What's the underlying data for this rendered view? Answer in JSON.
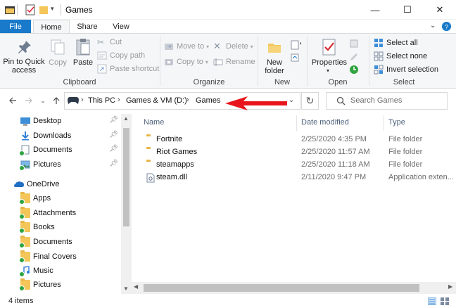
{
  "window": {
    "title": "Games",
    "controls": {
      "minimize": "—",
      "maximize": "☐",
      "close": "✕"
    }
  },
  "ribbon": {
    "tabs": [
      {
        "label": "File"
      },
      {
        "label": "Home"
      },
      {
        "label": "Share"
      },
      {
        "label": "View"
      }
    ],
    "clipboard": {
      "pin_label": "Pin to Quick access",
      "copy_label": "Copy",
      "paste_label": "Paste",
      "cut_label": "Cut",
      "copy_path_label": "Copy path",
      "paste_shortcut_label": "Paste shortcut",
      "group_label": "Clipboard"
    },
    "organize": {
      "move_to_label": "Move to",
      "copy_to_label": "Copy to",
      "delete_label": "Delete",
      "rename_label": "Rename",
      "group_label": "Organize"
    },
    "new": {
      "new_folder_label": "New folder",
      "group_label": "New"
    },
    "open": {
      "properties_label": "Properties",
      "group_label": "Open"
    },
    "select": {
      "select_all_label": "Select all",
      "select_none_label": "Select none",
      "invert_label": "Invert selection",
      "group_label": "Select"
    }
  },
  "address": {
    "crumbs": [
      "This PC",
      "Games & VM (D:)",
      "Games"
    ],
    "search_placeholder": "Search Games"
  },
  "nav": {
    "quick_access": [
      {
        "label": "Desktop",
        "icon": "desktop-icon",
        "pinned": true
      },
      {
        "label": "Downloads",
        "icon": "downloads-icon",
        "pinned": true
      },
      {
        "label": "Documents",
        "icon": "documents-icon",
        "pinned": true
      },
      {
        "label": "Pictures",
        "icon": "pictures-icon",
        "pinned": true
      }
    ],
    "onedrive_label": "OneDrive",
    "onedrive_items": [
      {
        "label": "Apps"
      },
      {
        "label": "Attachments"
      },
      {
        "label": "Books"
      },
      {
        "label": "Documents"
      },
      {
        "label": "Final Covers"
      },
      {
        "label": "Music"
      },
      {
        "label": "Pictures"
      }
    ]
  },
  "files": {
    "columns": {
      "name": "Name",
      "date": "Date modified",
      "type": "Type"
    },
    "rows": [
      {
        "name": "Fortnite",
        "date": "2/25/2020 4:35 PM",
        "type": "File folder",
        "icon": "folder-icon"
      },
      {
        "name": "Riot Games",
        "date": "2/25/2020 11:57 AM",
        "type": "File folder",
        "icon": "folder-icon"
      },
      {
        "name": "steamapps",
        "date": "2/25/2020 11:18 AM",
        "type": "File folder",
        "icon": "folder-icon"
      },
      {
        "name": "steam.dll",
        "date": "2/11/2020 9:47 PM",
        "type": "Application exten...",
        "icon": "dll-file-icon"
      }
    ]
  },
  "status": {
    "item_count": "4 items"
  },
  "colors": {
    "accent": "#1979ca",
    "annotation_arrow": "#e8161c",
    "folder": "#f4c65a"
  }
}
